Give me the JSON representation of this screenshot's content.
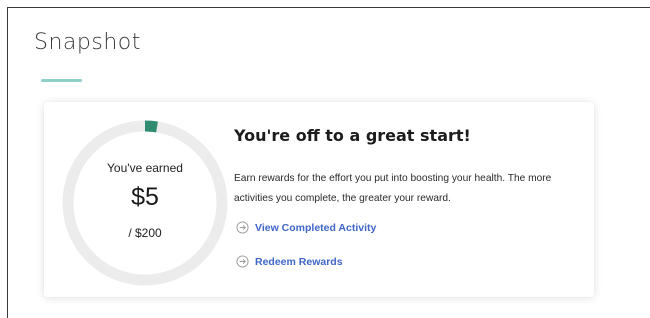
{
  "snapshot": {
    "title": "Snapshot"
  },
  "rewards_card": {
    "progress": {
      "earned_label": "You've earned",
      "earned_amount": "$5",
      "total_label": "/ $200",
      "earned_value": 5,
      "total_value": 200
    },
    "headline": "You're off to a great start!",
    "description": "Earn rewards for the effort you put into boosting your health. The more activities you complete, the greater your reward.",
    "links": [
      {
        "label": "View Completed Activity",
        "icon": "arrow-right-circle-icon"
      },
      {
        "label": "Redeem Rewards",
        "icon": "arrow-right-circle-icon"
      }
    ]
  },
  "colors": {
    "accent_teal": "#8ecfca",
    "progress_green": "#2f8c70",
    "ring_track": "#ececec",
    "link_blue": "#3f66c8"
  }
}
